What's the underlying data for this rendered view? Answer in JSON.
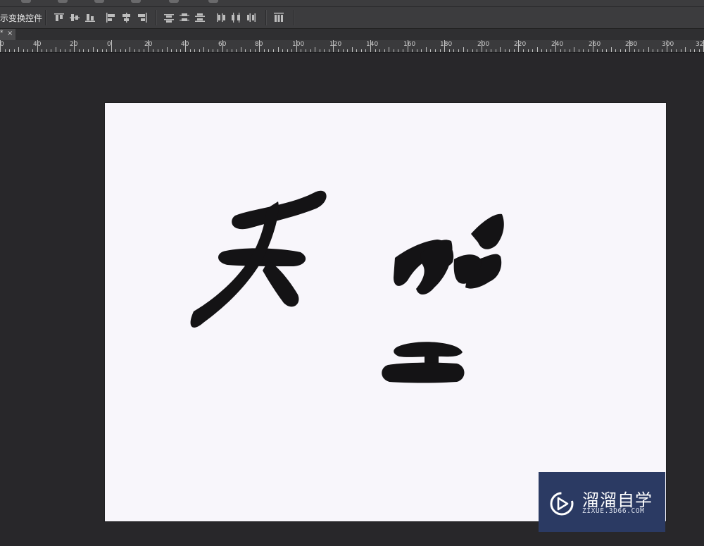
{
  "options_bar": {
    "transform_controls_label": "示变换控件",
    "align_buttons": [
      {
        "icon": "align-top-edges-icon"
      },
      {
        "icon": "align-vertical-centers-icon"
      },
      {
        "icon": "align-bottom-edges-icon"
      },
      {
        "icon": "align-left-edges-icon"
      },
      {
        "icon": "align-horizontal-centers-icon"
      },
      {
        "icon": "align-right-edges-icon"
      },
      {
        "icon": "distribute-top-edges-icon"
      },
      {
        "icon": "distribute-vertical-centers-icon"
      },
      {
        "icon": "distribute-bottom-edges-icon"
      },
      {
        "icon": "distribute-left-edges-icon"
      },
      {
        "icon": "distribute-horizontal-centers-icon"
      },
      {
        "icon": "distribute-right-edges-icon"
      },
      {
        "icon": "auto-align-layers-icon"
      }
    ]
  },
  "document_tab": {
    "modified_marker": "*",
    "close_glyph": "×"
  },
  "ruler": {
    "labels": [
      "0",
      "40",
      "20",
      "0",
      "20",
      "40",
      "60",
      "80",
      "100",
      "120",
      "140",
      "160",
      "180",
      "200",
      "220",
      "240",
      "260",
      "280",
      "300",
      "32"
    ]
  },
  "canvas": {
    "background": "#f8f6fb",
    "artwork": "calligraphy glyphs in black brush strokes"
  },
  "watermark": {
    "title": "溜溜自学",
    "subtitle": "ZIXUE.3D66.COM",
    "background": "#2b3a63"
  },
  "colors": {
    "workspace": "#28272a",
    "panel": "#3c3c3e",
    "ink": "#141315"
  }
}
